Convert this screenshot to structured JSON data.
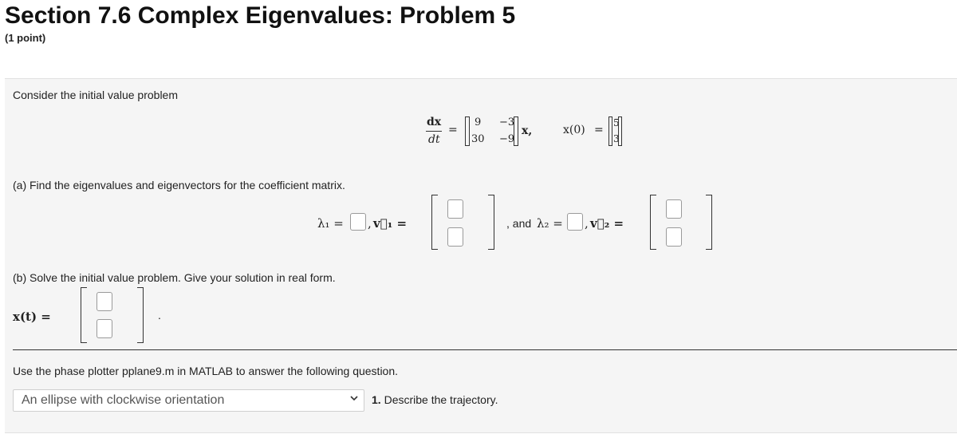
{
  "page": {
    "title": "Section 7.6 Complex Eigenvalues: Problem 5",
    "points": "(1 point)"
  },
  "problem": {
    "intro": "Consider the initial value problem",
    "equation": {
      "lhs_num": "dx",
      "lhs_den": "dt",
      "equals": "=",
      "matrix": [
        "9",
        "−3",
        "30",
        "−9"
      ],
      "rhs_var": "x,",
      "ic_label": "x(0)",
      "ic_equals": "=",
      "ic_vector": [
        "5",
        "3"
      ]
    },
    "part_a": {
      "prompt": "(a) Find the eigenvalues and eigenvectors for the coefficient matrix.",
      "lambda1": "λ₁ =",
      "sep1": ",",
      "v1": "v⃗₁ =",
      "and": ", and",
      "lambda2": "λ₂ =",
      "sep2": ",",
      "v2": "v⃗₂ ="
    },
    "part_b": {
      "prompt": "(b) Solve the initial value problem. Give your solution in real form.",
      "xt": "x(t) =",
      "period": "."
    },
    "matlab": {
      "instruction": "Use the phase plotter pplane9.m in MATLAB to answer the following question.",
      "select_value": "An ellipse with clockwise orientation",
      "question_number": "1.",
      "question_text": "Describe the trajectory."
    }
  }
}
